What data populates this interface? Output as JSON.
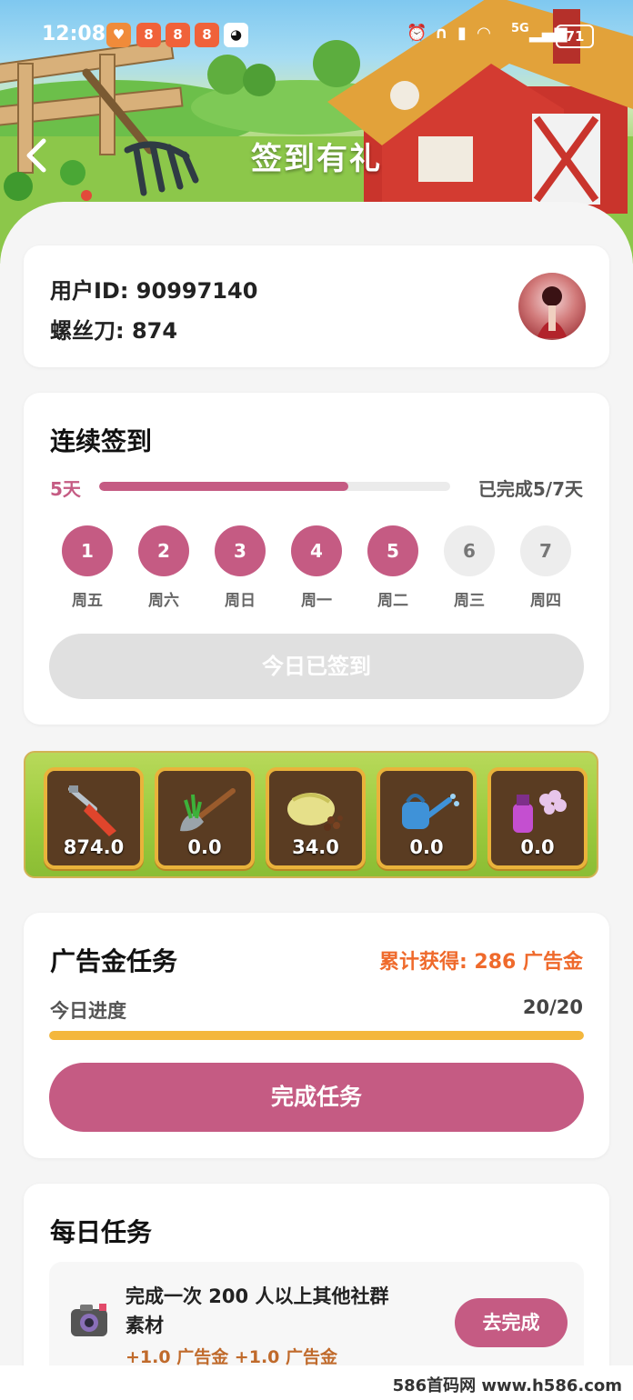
{
  "status_bar": {
    "time": "12:08",
    "network": "5G",
    "battery": "71",
    "apps": [
      {
        "icon": "heart-app-icon",
        "color": "#f08b3a"
      },
      {
        "icon": "app-icon",
        "color": "#f0623a"
      },
      {
        "icon": "app-icon",
        "color": "#f0623a"
      },
      {
        "icon": "app-icon",
        "color": "#f0623a"
      },
      {
        "icon": "qq-penguin-icon",
        "color": "#ffffff"
      }
    ]
  },
  "header": {
    "title": "签到有礼",
    "back_icon": "chevron-left-icon"
  },
  "user": {
    "id_label": "用户ID: 90997140",
    "tool_label": "螺丝刀: 874",
    "avatar_icon": "avatar-icon"
  },
  "signin": {
    "title": "连续签到",
    "current_label": "5天",
    "completed_label": "已完成5/7天",
    "progress": 0.71,
    "days": [
      {
        "num": "1",
        "weekday": "周五",
        "done": true
      },
      {
        "num": "2",
        "weekday": "周六",
        "done": true
      },
      {
        "num": "3",
        "weekday": "周日",
        "done": true
      },
      {
        "num": "4",
        "weekday": "周一",
        "done": true
      },
      {
        "num": "5",
        "weekday": "周二",
        "done": true
      },
      {
        "num": "6",
        "weekday": "周三",
        "done": false
      },
      {
        "num": "7",
        "weekday": "周四",
        "done": false
      }
    ],
    "button_label": "今日已签到"
  },
  "tools": [
    {
      "icon": "screwdriver-icon",
      "value": "874.0"
    },
    {
      "icon": "shovel-icon",
      "value": "0.0"
    },
    {
      "icon": "seed-bag-icon",
      "value": "34.0"
    },
    {
      "icon": "watering-can-icon",
      "value": "0.0"
    },
    {
      "icon": "spray-bottle-icon",
      "value": "0.0"
    }
  ],
  "ad_task": {
    "title": "广告金任务",
    "total_label": "累计获得: 286 广告金",
    "progress_label": "今日进度",
    "progress_value": "20/20",
    "progress": 1.0,
    "button_label": "完成任务"
  },
  "daily": {
    "title": "每日任务",
    "task": {
      "icon": "camera-icon",
      "title_line1": "完成一次 200 人以上其他社群",
      "title_line2": "素材",
      "reward": "+1.0 广告金 +1.0 广告金",
      "button_label": "去完成"
    }
  },
  "watermark": "586首码网 www.h586.com",
  "colors": {
    "accent": "#c55b83",
    "orange": "#ef6a2c",
    "gold": "#f4b73c",
    "disabled": "#e0e0e0"
  }
}
